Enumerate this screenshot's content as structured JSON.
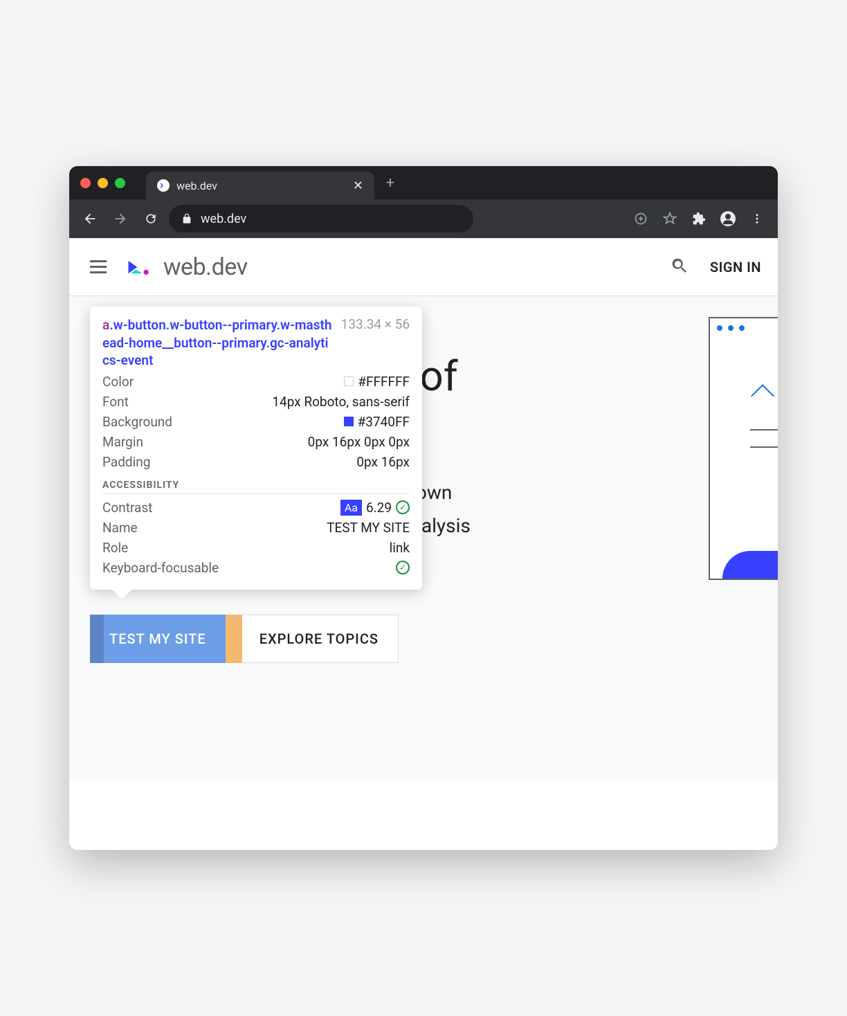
{
  "browser": {
    "tab_title": "web.dev",
    "url": "web.dev"
  },
  "header": {
    "logo_text": "web.dev",
    "signin": "SIGN IN"
  },
  "hero": {
    "title_fragment": "re of",
    "text_line1": "your own",
    "text_line2": "nd analysis"
  },
  "buttons": {
    "primary": "TEST MY SITE",
    "secondary": "EXPLORE TOPICS"
  },
  "tooltip": {
    "selector_tag": "a",
    "selector_rest": ".w-button.w-button--primary.w-masthead-home__button--primary.gc-analytics-event",
    "dimensions": "133.34 × 56",
    "rows": {
      "color_label": "Color",
      "color_value": "#FFFFFF",
      "font_label": "Font",
      "font_value": "14px Roboto, sans-serif",
      "background_label": "Background",
      "background_value": "#3740FF",
      "margin_label": "Margin",
      "margin_value": "0px 16px 0px 0px",
      "padding_label": "Padding",
      "padding_value": "0px 16px"
    },
    "accessibility_heading": "ACCESSIBILITY",
    "a11y": {
      "contrast_label": "Contrast",
      "contrast_badge": "Aa",
      "contrast_value": "6.29",
      "name_label": "Name",
      "name_value": "TEST MY SITE",
      "role_label": "Role",
      "role_value": "link",
      "keyboard_label": "Keyboard-focusable"
    }
  }
}
